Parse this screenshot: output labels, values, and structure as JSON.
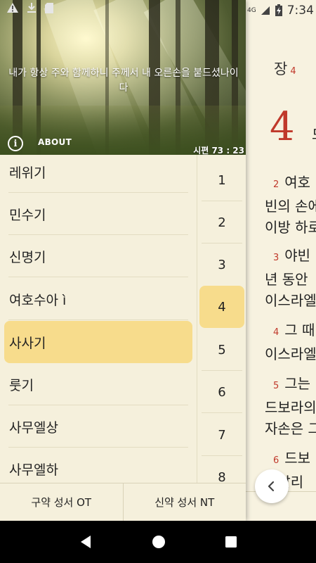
{
  "status_bar": {
    "network": "4G",
    "time": "7:34"
  },
  "reader": {
    "chapter_label": "장",
    "chapter_num": "4",
    "big_chapter_num": "4",
    "big_after": "드",
    "verses": [
      {
        "num": "2",
        "lines": [
          "여호",
          "빈의 손에",
          "이방 하로"
        ]
      },
      {
        "num": "3",
        "lines": [
          "야빈",
          "년 동안",
          "이스라엘"
        ]
      },
      {
        "num": "4",
        "lines": [
          "그 때",
          "이스라엘"
        ]
      },
      {
        "num": "5",
        "lines": [
          "그는",
          "드보라의",
          "자손은 그"
        ]
      },
      {
        "num": "6",
        "lines": [
          "드보",
          "납달리"
        ]
      }
    ]
  },
  "hero": {
    "quote": "내가 항상 주와 함께하니 주께서 내 오른손을 붙드셨나이다",
    "about_label": "ABOUT",
    "reference": "시편    73 : 23"
  },
  "books": [
    "레위기",
    "민수기",
    "신명기",
    "여호수아 ì",
    "사사기",
    "룻기",
    "사무엘상",
    "사무엘하"
  ],
  "selected_book": "사사기",
  "chapters": [
    "1",
    "2",
    "3",
    "4",
    "5",
    "6",
    "7",
    "8"
  ],
  "selected_chapter": "4",
  "testament_tabs": {
    "ot": "구약 성서 OT",
    "nt": "신약 성서 NT"
  },
  "colors": {
    "accent": "#f7dc8c",
    "verse_number": "#c0392b",
    "background": "#f5f0dc"
  }
}
